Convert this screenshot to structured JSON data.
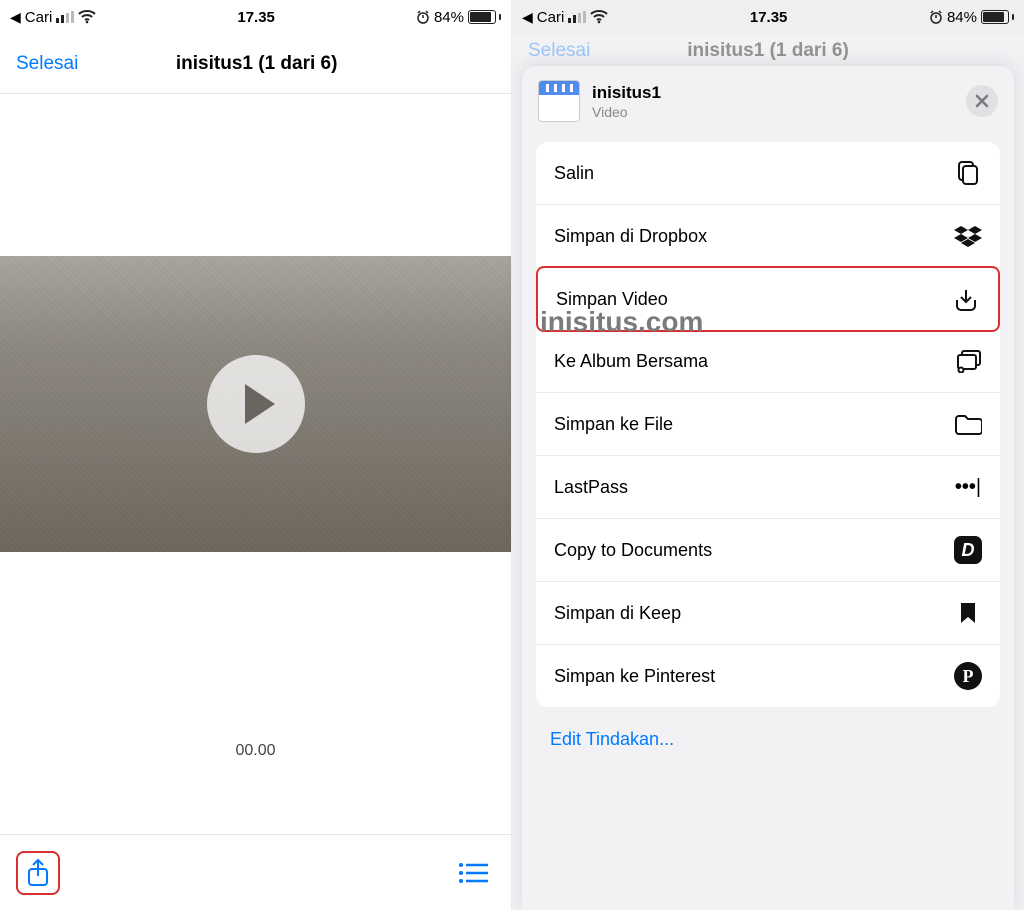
{
  "status": {
    "back_label": "Cari",
    "time": "17.35",
    "battery_pct": "84%"
  },
  "left": {
    "done_label": "Selesai",
    "title": "inisitus1 (1 dari 6)",
    "time_label": "00.00"
  },
  "right": {
    "dimmed_done": "Selesai",
    "dimmed_title": "inisitus1 (1 dari 6)",
    "file_title": "inisitus1",
    "file_subtitle": "Video",
    "watermark": "inisitus.com",
    "actions": [
      {
        "label": "Salin",
        "icon": "copy",
        "highlight": false
      },
      {
        "label": "Simpan di Dropbox",
        "icon": "dropbox",
        "highlight": false
      },
      {
        "label": "Simpan Video",
        "icon": "download",
        "highlight": true
      },
      {
        "label": "Ke Album Bersama",
        "icon": "shared-album",
        "highlight": false
      },
      {
        "label": "Simpan ke File",
        "icon": "folder",
        "highlight": false
      },
      {
        "label": "LastPass",
        "icon": "lastpass",
        "highlight": false
      },
      {
        "label": "Copy to Documents",
        "icon": "documents-app",
        "highlight": false
      },
      {
        "label": "Simpan di Keep",
        "icon": "bookmark",
        "highlight": false
      },
      {
        "label": "Simpan ke Pinterest",
        "icon": "pinterest",
        "highlight": false
      }
    ],
    "edit_label": "Edit Tindakan..."
  }
}
